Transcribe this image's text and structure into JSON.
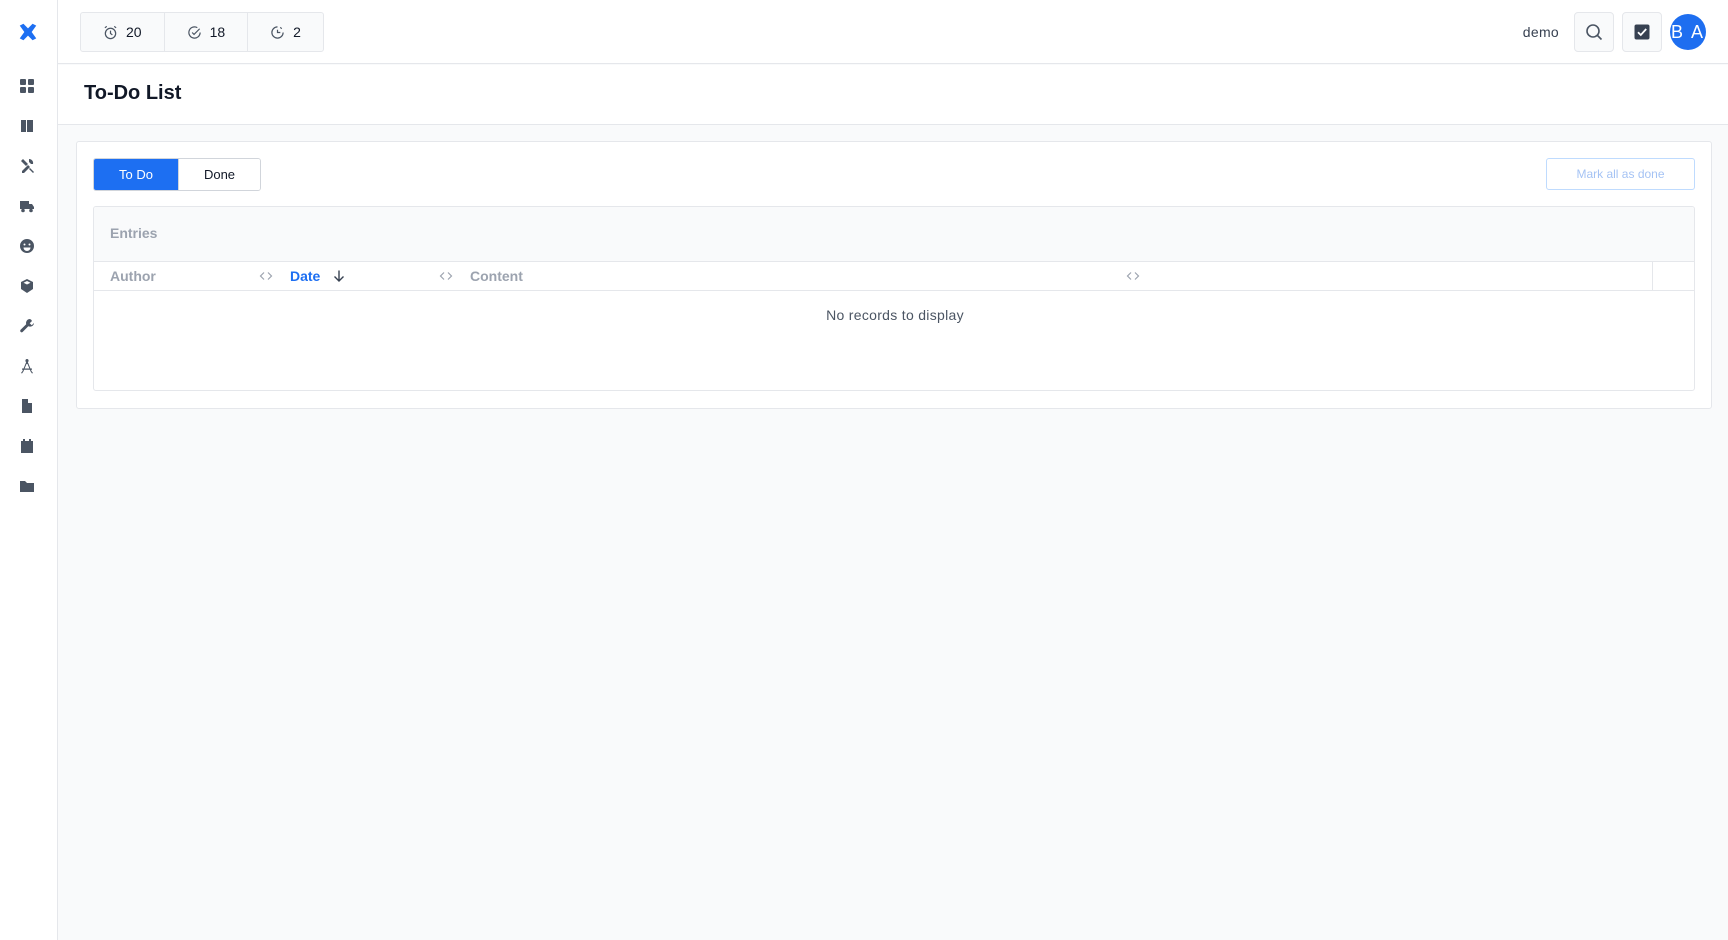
{
  "header": {
    "stats": [
      {
        "icon": "alarm-clock-icon",
        "value": "20"
      },
      {
        "icon": "check-circle-icon",
        "value": "18"
      },
      {
        "icon": "clock-icon",
        "value": "2"
      }
    ],
    "username": "demo",
    "avatar_initials": "B A"
  },
  "sidebar": {
    "items": [
      {
        "name": "dashboard",
        "icon": "grid-icon"
      },
      {
        "name": "catalog",
        "icon": "book-icon"
      },
      {
        "name": "tools",
        "icon": "tools-icon"
      },
      {
        "name": "shipping",
        "icon": "truck-icon"
      },
      {
        "name": "customers",
        "icon": "smiley-icon"
      },
      {
        "name": "products",
        "icon": "cubes-icon"
      },
      {
        "name": "settings",
        "icon": "wrench-icon"
      },
      {
        "name": "design",
        "icon": "compass-icon"
      },
      {
        "name": "documents",
        "icon": "file-icon"
      },
      {
        "name": "calendar",
        "icon": "calendar-icon"
      },
      {
        "name": "files",
        "icon": "folder-icon"
      }
    ]
  },
  "page": {
    "title": "To-Do List"
  },
  "tabs": {
    "todo": "To Do",
    "done": "Done",
    "active": "todo"
  },
  "actions": {
    "mark_all": "Mark all as done"
  },
  "entries": {
    "title": "Entries",
    "columns": [
      "Author",
      "Date",
      "Content"
    ],
    "sorted_column": "Date",
    "sort_direction": "descending",
    "empty_message": "No records to display"
  },
  "colors": {
    "accent": "#1d6ff2",
    "avatar": "#1e6ef0"
  }
}
